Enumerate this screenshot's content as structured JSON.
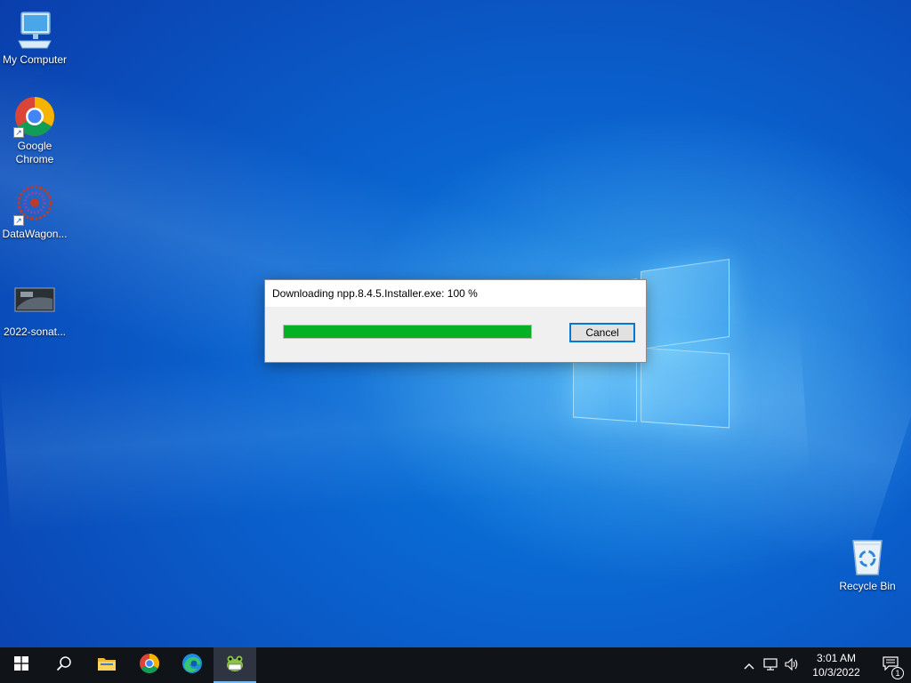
{
  "desktop": {
    "icons": [
      {
        "label": "My Computer",
        "icon": "monitor-icon"
      },
      {
        "label": "Google Chrome",
        "icon": "chrome-icon"
      },
      {
        "label": "DataWagon...",
        "icon": "datawagon-icon"
      },
      {
        "label": "2022-sonat...",
        "icon": "image-thumbnail-icon"
      },
      {
        "label": "Recycle Bin",
        "icon": "recycle-bin-icon"
      }
    ]
  },
  "dialog": {
    "title": "Downloading npp.8.4.5.Installer.exe: 100 %",
    "progress_percent": 100,
    "progress_color": "#06b025",
    "cancel_label": "Cancel"
  },
  "taskbar": {
    "buttons": [
      {
        "name": "start",
        "icon": "windows-icon"
      },
      {
        "name": "search",
        "icon": "search-icon"
      },
      {
        "name": "file-explorer",
        "icon": "folder-icon"
      },
      {
        "name": "chrome",
        "icon": "chrome-icon"
      },
      {
        "name": "edge",
        "icon": "edge-icon"
      },
      {
        "name": "notepad-plus-plus",
        "icon": "notepad-plus-plus-icon",
        "active": true
      }
    ],
    "tray": {
      "time": "3:01 AM",
      "date": "10/3/2022",
      "notification_count": "1"
    }
  }
}
